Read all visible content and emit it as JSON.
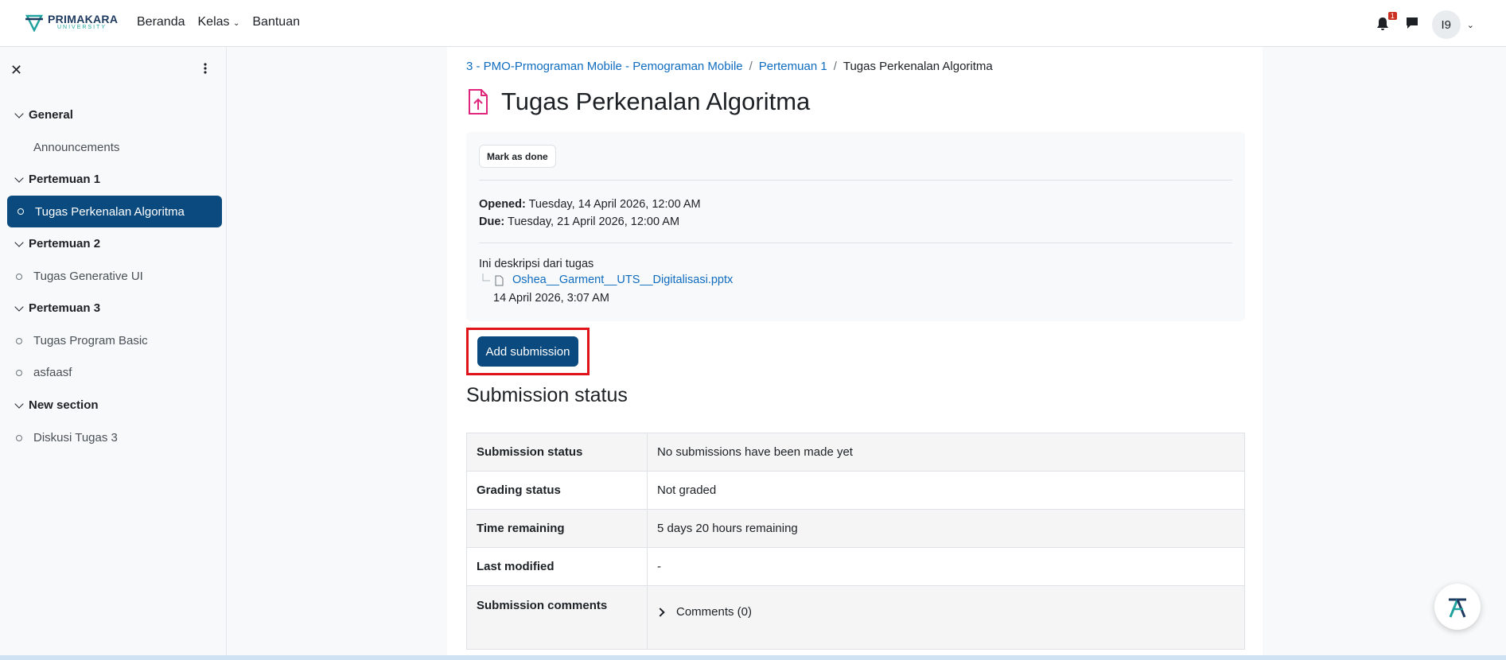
{
  "header": {
    "logo_main": "PRIMAKARA",
    "logo_sub": "UNIVERSITY",
    "nav": [
      "Beranda",
      "Kelas",
      "Bantuan"
    ],
    "notification_count": "1",
    "avatar_initials": "I9"
  },
  "sidebar": {
    "sections": [
      {
        "label": "General",
        "items": [
          "Announcements"
        ]
      },
      {
        "label": "Pertemuan 1",
        "items": [
          "Tugas Perkenalan Algoritma"
        ]
      },
      {
        "label": "Pertemuan 2",
        "items": [
          "Tugas Generative UI"
        ]
      },
      {
        "label": "Pertemuan 3",
        "items": [
          "Tugas Program Basic",
          "asfaasf"
        ]
      },
      {
        "label": "New section",
        "items": [
          "Diskusi Tugas 3"
        ]
      }
    ]
  },
  "breadcrumb": {
    "course": "3 - PMO-Prmograman Mobile - Pemograman Mobile",
    "section": "Pertemuan 1",
    "current": "Tugas Perkenalan Algoritma"
  },
  "page": {
    "title": "Tugas Perkenalan Algoritma",
    "mark_done": "Mark as done",
    "opened_label": "Opened:",
    "opened_value": "Tuesday, 14 April 2026, 12:00 AM",
    "due_label": "Due:",
    "due_value": "Tuesday, 21 April 2026, 12:00 AM",
    "description": "Ini deskripsi dari tugas",
    "file_name": "Oshea__Garment__UTS__Digitalisasi.pptx",
    "file_date": "14 April 2026, 3:07 AM",
    "add_submission": "Add submission",
    "submission_heading": "Submission status"
  },
  "status_table": [
    {
      "label": "Submission status",
      "value": "No submissions have been made yet"
    },
    {
      "label": "Grading status",
      "value": "Not graded"
    },
    {
      "label": "Time remaining",
      "value": "5 days 20 hours remaining"
    },
    {
      "label": "Last modified",
      "value": "-"
    },
    {
      "label": "Submission comments",
      "value": "Comments (0)"
    }
  ],
  "colors": {
    "primary": "#0b4a7f",
    "link": "#0f6cbf",
    "highlight": "#e0131b",
    "icon_accent": "#e0267a"
  }
}
